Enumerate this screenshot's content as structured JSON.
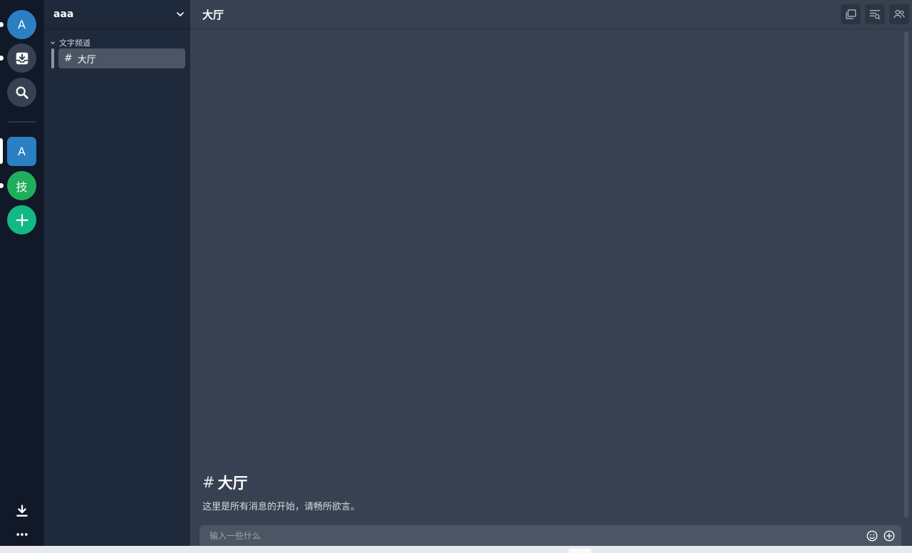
{
  "rail": {
    "items": [
      {
        "label": "A",
        "color": "#2b7fc3"
      },
      {
        "icon": "inbox-icon"
      },
      {
        "icon": "search-icon"
      },
      {
        "label": "A",
        "color": "#2b7fc3"
      },
      {
        "label": "技",
        "color": "#1fae5b"
      },
      {
        "icon": "plus-icon",
        "color": "#13b884"
      }
    ],
    "bottom": [
      {
        "icon": "download-icon"
      },
      {
        "icon": "more-icon"
      }
    ]
  },
  "guild": {
    "name": "aaa",
    "category": "文字频道",
    "channels": [
      {
        "name": "大厅",
        "active": true
      }
    ]
  },
  "main": {
    "title": "大厅",
    "welcome_hash": "#",
    "welcome_title": "大厅",
    "welcome_desc": "这里是所有消息的开始，请畅所欲言。",
    "composer_placeholder": "输入一些什么"
  },
  "colors": {
    "rail_bg": "#111827",
    "sidebar_bg": "#1e293b",
    "main_bg": "#374151",
    "active_channel_bg": "#4b5563"
  }
}
